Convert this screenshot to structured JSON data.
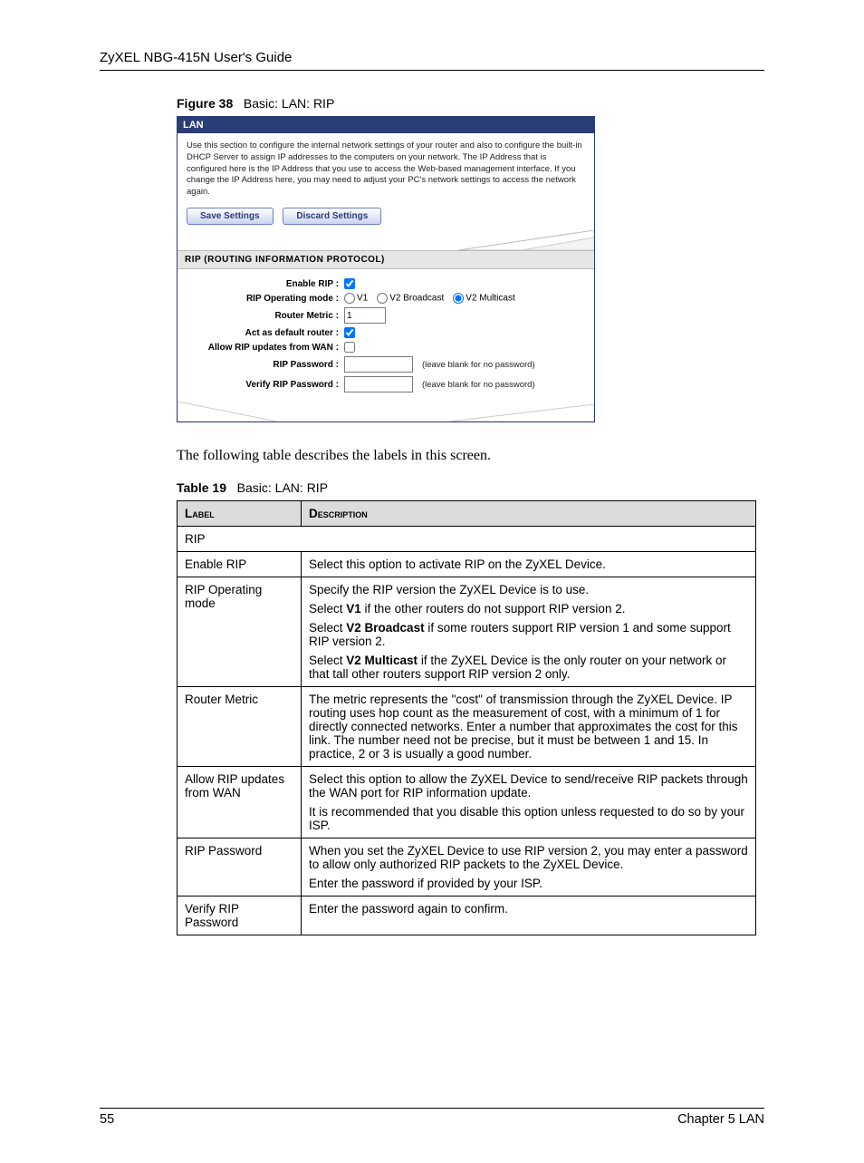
{
  "header": {
    "title": "ZyXEL NBG-415N User's Guide"
  },
  "figure": {
    "label": "Figure 38",
    "title": "Basic: LAN: RIP"
  },
  "ui": {
    "titlebar": "LAN",
    "description": "Use this section to configure the internal network settings of your router and also to configure the built-in DHCP Server to assign IP addresses to the computers on your network. The IP Address that is configured here is the IP Address that you use to access the Web-based management interface. If you change the IP Address here, you may need to adjust your PC's network settings to access the network again.",
    "buttons": {
      "save": "Save Settings",
      "discard": "Discard Settings"
    },
    "section_head": "RIP (ROUTING INFORMATION PROTOCOL)",
    "rows": {
      "enable_rip": "Enable RIP :",
      "op_mode": "RIP Operating mode :",
      "op_v1": "V1",
      "op_v2b": "V2 Broadcast",
      "op_v2m": "V2 Multicast",
      "router_metric": "Router Metric :",
      "router_metric_val": "1",
      "default_router": "Act as default router :",
      "allow_wan": "Allow RIP updates from WAN :",
      "rip_pw": "RIP Password :",
      "verify_pw": "Verify RIP Password :",
      "pw_note": "(leave blank for no password)"
    }
  },
  "body_text": "The following table describes the labels in this screen.",
  "table_caption": {
    "label": "Table 19",
    "title": "Basic: LAN: RIP"
  },
  "table": {
    "th_label": "Label",
    "th_desc": "Description",
    "rows": [
      {
        "label": "RIP",
        "desc": [],
        "span": true
      },
      {
        "label": "Enable RIP",
        "desc": [
          "Select this option to activate RIP on the ZyXEL Device."
        ]
      },
      {
        "label": "RIP Operating mode",
        "desc": [
          "Specify the RIP version the ZyXEL Device is to use.",
          "Select <b>V1</b> if the other routers do not support RIP version 2.",
          "Select <b>V2 Broadcast</b> if some routers support RIP version 1 and some support RIP version 2.",
          "Select <b>V2 Multicast</b> if the ZyXEL Device is the only router on your network or that tall other routers support RIP version 2 only."
        ]
      },
      {
        "label": "Router Metric",
        "desc": [
          "The metric represents the \"cost\" of transmission through the ZyXEL Device. IP routing uses hop count as the measurement of cost, with a minimum of 1 for directly connected networks. Enter a number that approximates the cost for this link. The number need not be precise, but it must be between 1 and 15. In practice, 2 or 3 is usually a good number."
        ]
      },
      {
        "label": "Allow RIP updates from WAN",
        "desc": [
          "Select this option to allow the ZyXEL Device to send/receive RIP packets through the WAN port for RIP information update.",
          "It is recommended that you disable this option unless requested to do so by your ISP."
        ]
      },
      {
        "label": "RIP Password",
        "desc": [
          "When you set the ZyXEL Device to use RIP version 2, you may enter a password to allow only authorized RIP packets to the ZyXEL Device.",
          "Enter the password if provided by your ISP."
        ]
      },
      {
        "label": "Verify RIP Password",
        "desc": [
          "Enter the password again to confirm."
        ]
      }
    ]
  },
  "footer": {
    "page": "55",
    "chapter": "Chapter 5 LAN"
  }
}
